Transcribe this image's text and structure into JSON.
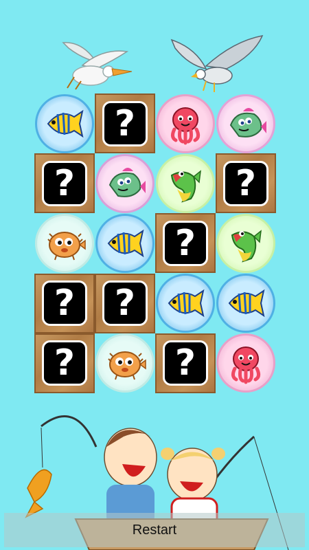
{
  "restart_label": "Restart",
  "board": {
    "columns": 4,
    "rows": 5,
    "hidden_symbol": "?",
    "cells": [
      {
        "state": "revealed",
        "icon": "yellow-tang-fish-icon",
        "ring": "#4fb0e4",
        "fill": "#c9ecff"
      },
      {
        "state": "hidden",
        "icon": "question-mark-icon"
      },
      {
        "state": "revealed",
        "icon": "red-octopus-icon",
        "ring": "#e8a0c8",
        "fill": "#ffd6ea"
      },
      {
        "state": "revealed",
        "icon": "green-fish-icon",
        "ring": "#e3a2d6",
        "fill": "#fde0f4"
      },
      {
        "state": "hidden",
        "icon": "question-mark-icon"
      },
      {
        "state": "revealed",
        "icon": "green-fish-icon",
        "ring": "#d9a0d8",
        "fill": "#fde0f4"
      },
      {
        "state": "revealed",
        "icon": "green-carp-icon",
        "ring": "#c7f0a4",
        "fill": "#e9ffd4"
      },
      {
        "state": "hidden",
        "icon": "question-mark-icon"
      },
      {
        "state": "revealed",
        "icon": "orange-pufferfish-icon",
        "ring": "#bfeae4",
        "fill": "#e6fbf6"
      },
      {
        "state": "revealed",
        "icon": "yellow-tang-fish-icon",
        "ring": "#4fb0e4",
        "fill": "#c9ecff"
      },
      {
        "state": "hidden",
        "icon": "question-mark-icon"
      },
      {
        "state": "revealed",
        "icon": "green-carp-icon",
        "ring": "#c7f0a4",
        "fill": "#e9ffd4"
      },
      {
        "state": "hidden",
        "icon": "question-mark-icon"
      },
      {
        "state": "hidden",
        "icon": "question-mark-icon"
      },
      {
        "state": "revealed",
        "icon": "yellow-tang-fish-icon",
        "ring": "#4fb0e4",
        "fill": "#c9ecff"
      },
      {
        "state": "revealed",
        "icon": "yellow-tang-fish-icon",
        "ring": "#4fb0e4",
        "fill": "#c9ecff"
      },
      {
        "state": "hidden",
        "icon": "question-mark-icon"
      },
      {
        "state": "revealed",
        "icon": "orange-pufferfish-icon",
        "ring": "#bfeae4",
        "fill": "#e6fbf6"
      },
      {
        "state": "hidden",
        "icon": "question-mark-icon"
      },
      {
        "state": "revealed",
        "icon": "red-octopus-icon",
        "ring": "#e8a0c8",
        "fill": "#ffd6ea"
      }
    ]
  },
  "colors": {
    "background": "#7fe9f2",
    "tile_wood": "#b88548",
    "question_box": "#000000"
  }
}
